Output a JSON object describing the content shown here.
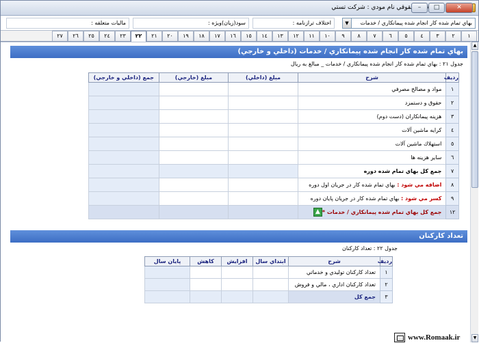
{
  "window": {
    "title": "اظهارنامه اشخاص حقوقي    نام مودي : شركت تستي",
    "min_label": "–",
    "max_label": "□",
    "close_label": "✕"
  },
  "info": {
    "combo_value": "بهاي تمام شده كار انجام شده پيمانكاري / خدمات",
    "ekhtelaf_label": "اختلاف ترازنامه :",
    "sood_label": "سود(زيان)ويژه :",
    "maliyat_label": "ماليات متعلقه :"
  },
  "tabs": [
    "١",
    "٢",
    "٣",
    "٤",
    "٥",
    "٦",
    "٧",
    "٨",
    "٩",
    "١٠",
    "١١",
    "١٢",
    "١٣",
    "١٤",
    "١٥",
    "١٦",
    "١٧",
    "١٨",
    "١٩",
    "٢٠",
    "٢١",
    "٢٢",
    "٢٣",
    "٢٤",
    "٢٥",
    "٢٦",
    "٢٧"
  ],
  "active_tab": "٢٢",
  "section1": {
    "title": "بهاي تمام شده كار انجام شده پيمانكاري / خدمات (داخلي و خارجي)",
    "caption": "جدول ٢١ : بهاي تمام شده كار انجام شده پيمانكاري / خدمات _ مبالغ به ريال",
    "headers": [
      "رديف",
      "شرح",
      "مبلغ (داخلي)",
      "مبلغ (خارجي)",
      "جمع (داخلي و خارجي)"
    ],
    "rows": [
      {
        "num": "١",
        "desc": "مواد و مصالح مصرفي"
      },
      {
        "num": "٢",
        "desc": "حقوق و دستمزد"
      },
      {
        "num": "٣",
        "desc": "هزينه پيمانكاران (دست دوم)"
      },
      {
        "num": "٤",
        "desc": "كرايه ماشين آلات"
      },
      {
        "num": "٥",
        "desc": "استهلاك ماشين آلات"
      },
      {
        "num": "٦",
        "desc": "ساير هزينه ها"
      },
      {
        "num": "٧",
        "desc": "جمع كل بهاي تمام شده دوره"
      },
      {
        "num": "٨",
        "red": "اضافه مي شود :",
        "desc": "بهاي تمام شده كار در جريان اول دوره"
      },
      {
        "num": "٩",
        "red": "كسر مي شود :",
        "desc": "بهاي تمام شده كار در جريان پايان دوره"
      },
      {
        "num": "١٢",
        "desc": "جمع كل بهاي تمام شده پيمانكاري / خدمات *"
      }
    ]
  },
  "section2": {
    "title": "تعداد كاركنان",
    "caption": "جدول ٢٢ : تعداد كاركنان",
    "headers": [
      "رديف",
      "شرح",
      "ابتداي سال",
      "افزايش",
      "كاهش",
      "پايان سال"
    ],
    "rows": [
      {
        "num": "١",
        "desc": "تعداد كاركنان توليدي و خدماتي"
      },
      {
        "num": "٢",
        "desc": "تعداد كاركنان اداري ، مالي و فروش"
      },
      {
        "num": "٣",
        "desc": "جمع كل"
      }
    ]
  },
  "watermark": "www.Romaak.ir"
}
